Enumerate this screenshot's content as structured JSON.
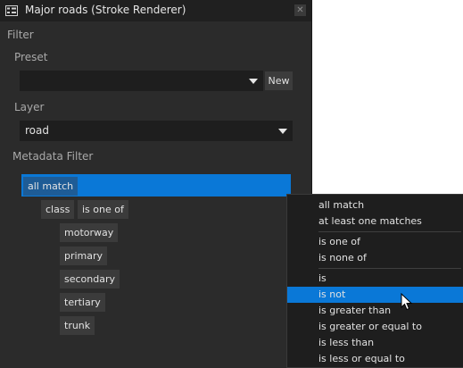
{
  "window": {
    "title": "Major roads (Stroke Renderer)",
    "close_glyph": "✕"
  },
  "filter": {
    "section_label": "Filter",
    "preset": {
      "label": "Preset",
      "value": "",
      "new_button": "New"
    },
    "layer": {
      "label": "Layer",
      "value": "road"
    },
    "metadata": {
      "label": "Metadata Filter",
      "root_operator": "all match",
      "condition": {
        "key": "class",
        "operator": "is one of",
        "values": [
          "motorway",
          "primary",
          "secondary",
          "tertiary",
          "trunk"
        ]
      }
    }
  },
  "menu": {
    "groups": [
      [
        "all match",
        "at least one matches"
      ],
      [
        "is one of",
        "is none of"
      ],
      [
        "is",
        "is not",
        "is greater than",
        "is greater or equal to",
        "is less than",
        "is less or equal to"
      ]
    ],
    "highlighted": "is not"
  },
  "colors": {
    "panel": "#2b2b2b",
    "accent": "#0a78d7",
    "chip": "#3b3b3b",
    "menu": "#1e1e1e"
  },
  "icons": {
    "title": "layer-panel-icon",
    "close": "close-icon",
    "dropdown": "chevron-down-icon",
    "cursor": "mouse-pointer-icon"
  }
}
